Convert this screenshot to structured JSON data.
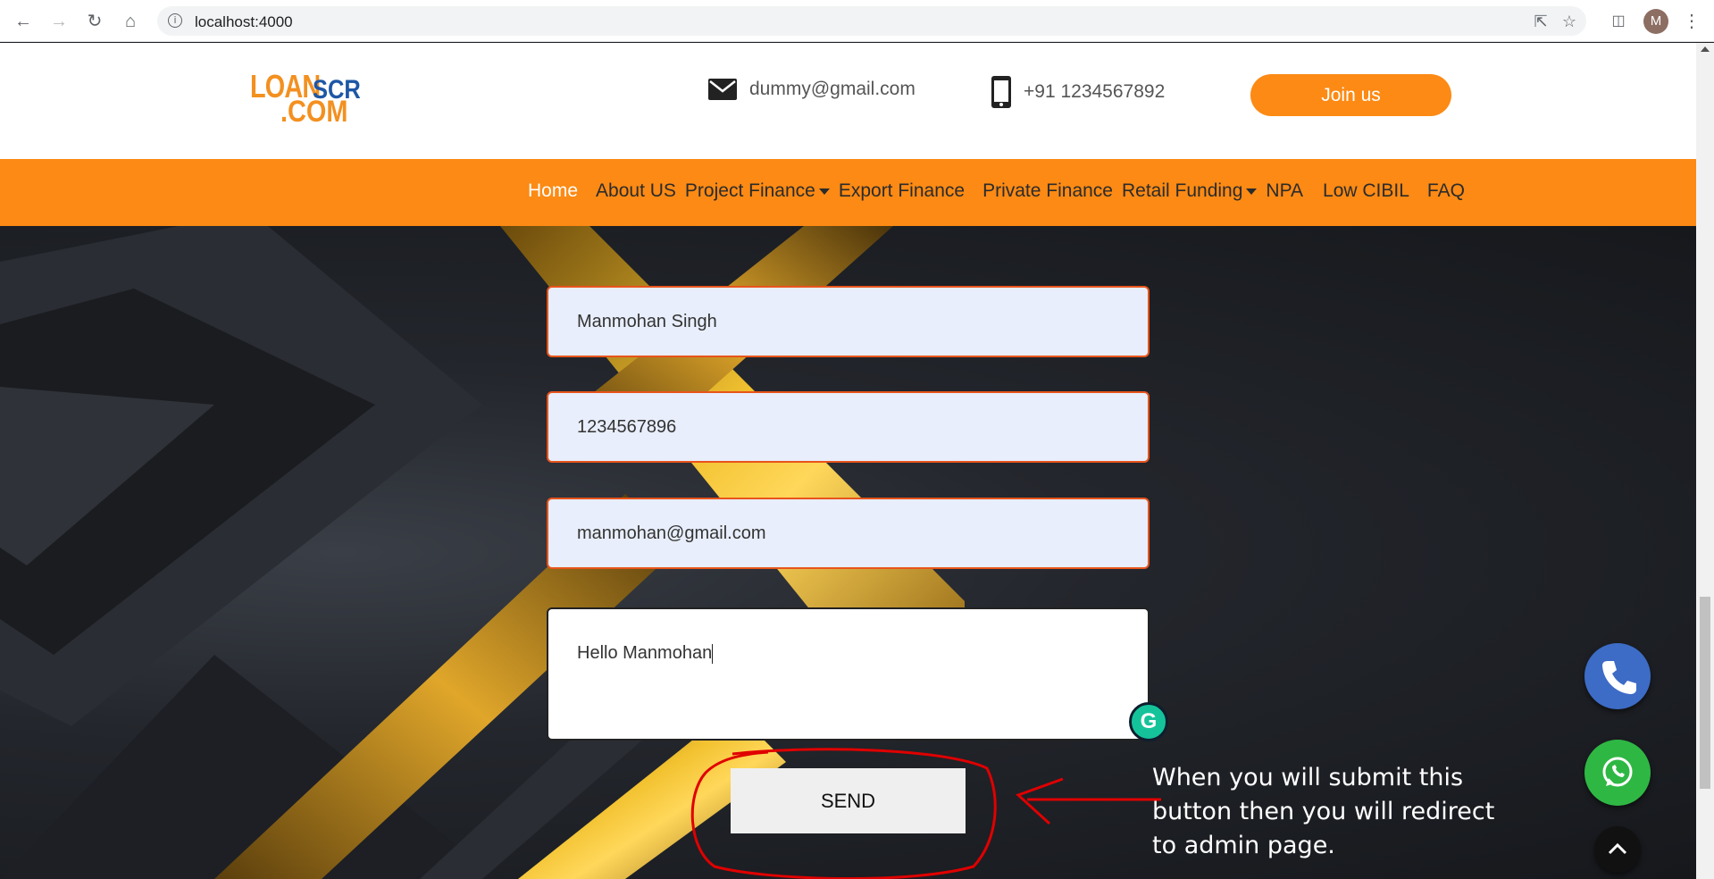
{
  "browser": {
    "url": "localhost:4000",
    "avatar_letter": "M"
  },
  "header": {
    "logo": {
      "part1": "LOAN",
      "part2": "SCR",
      "part3": ".COM"
    },
    "email": "dummy@gmail.com",
    "phone": "+91 1234567892",
    "join_label": "Join us"
  },
  "nav": {
    "items": [
      {
        "label": "Home",
        "active": true,
        "dropdown": false
      },
      {
        "label": "About US",
        "dropdown": false
      },
      {
        "label": "Project Finance",
        "dropdown": true
      },
      {
        "label": "Export Finance",
        "dropdown": false
      },
      {
        "label": "Private Finance",
        "dropdown": false
      },
      {
        "label": "Retail Funding",
        "dropdown": true
      },
      {
        "label": "NPA",
        "dropdown": false
      },
      {
        "label": "Low CIBIL",
        "dropdown": false
      },
      {
        "label": "FAQ",
        "dropdown": false
      }
    ]
  },
  "form": {
    "name_value": "Manmohan Singh",
    "phone_value": "1234567896",
    "email_value": "manmohan@gmail.com",
    "message_value": "Hello Manmohan",
    "send_label": "SEND"
  },
  "annotation": {
    "text": "When you will submit this button then you will redirect to admin page."
  },
  "colors": {
    "brand_orange": "#fc8a14",
    "brand_blue": "#1e57a5",
    "field_border": "#e8541b",
    "annotation_red": "#e00000"
  }
}
